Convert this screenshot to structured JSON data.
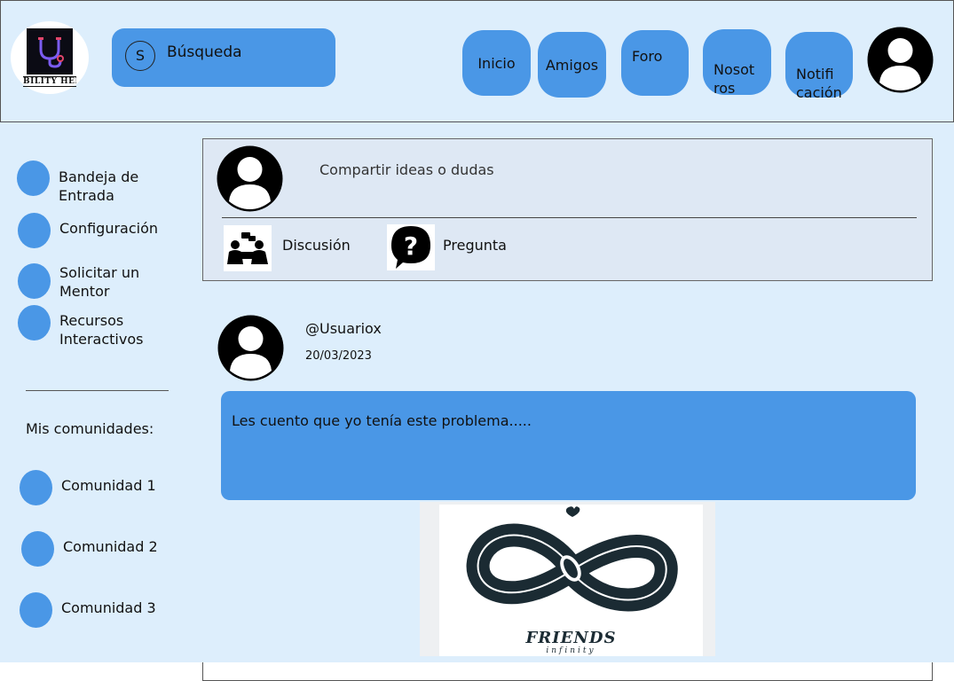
{
  "header": {
    "logo_text": "BILITY HEL",
    "search": {
      "initial": "S",
      "label": "Búsqueda"
    },
    "nav": [
      {
        "label": "Inicio"
      },
      {
        "label": "Amigos"
      },
      {
        "label": "Foro"
      },
      {
        "label": "Nosot\nros"
      },
      {
        "label": "Notifi\ncación"
      }
    ]
  },
  "sidebar": {
    "items": [
      {
        "label": "Bandeja de\nEntrada"
      },
      {
        "label": "Configuración"
      },
      {
        "label": "Solicitar un\nMentor"
      },
      {
        "label": "Recursos\nInteractivos"
      }
    ],
    "communities_title": "Mis comunidades:",
    "communities": [
      {
        "label": "Comunidad 1"
      },
      {
        "label": "Comunidad 2"
      },
      {
        "label": "Comunidad 3"
      }
    ]
  },
  "composer": {
    "placeholder": "Compartir ideas o dudas",
    "actions": [
      {
        "label": "Discusión",
        "icon": "discussion-icon"
      },
      {
        "label": "Pregunta",
        "icon": "question-icon"
      }
    ]
  },
  "post": {
    "username": "@Usuariox",
    "date": "20/03/2023",
    "body": "Les cuento que yo tenía este problema.....",
    "image": {
      "title": "FRIENDS",
      "subtitle": "infinity"
    }
  },
  "colors": {
    "background": "#ddeefc",
    "accent": "#4a97e6",
    "dark": "#0b0b14"
  }
}
